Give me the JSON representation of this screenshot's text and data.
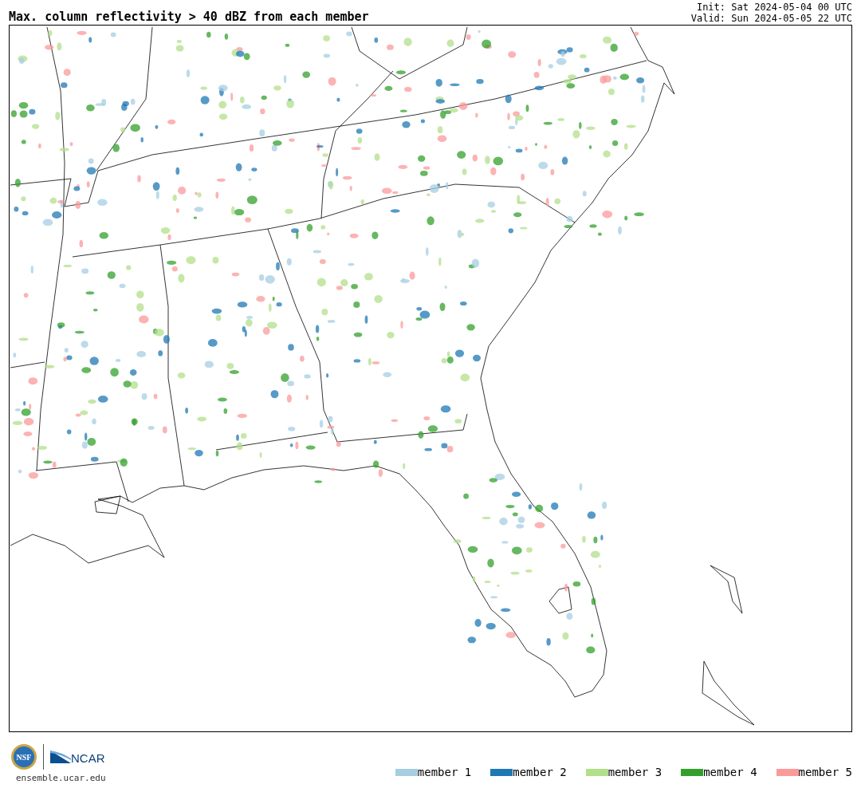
{
  "title": "Max. column reflectivity > 40 dBZ from each member",
  "init": "Init: Sat 2024-05-04 00 UTC",
  "valid": "Valid: Sun 2024-05-05 22 UTC",
  "logos": {
    "nsf": "NSF",
    "ncar": "NCAR"
  },
  "url": "ensemble.ucar.edu",
  "legend": [
    {
      "label": "member 1",
      "color": "#a6cee3"
    },
    {
      "label": "member 2",
      "color": "#1f78b4"
    },
    {
      "label": "member 3",
      "color": "#b2df8a"
    },
    {
      "label": "member 4",
      "color": "#33a02c"
    },
    {
      "label": "member 5",
      "color": "#fb9a99"
    }
  ]
}
